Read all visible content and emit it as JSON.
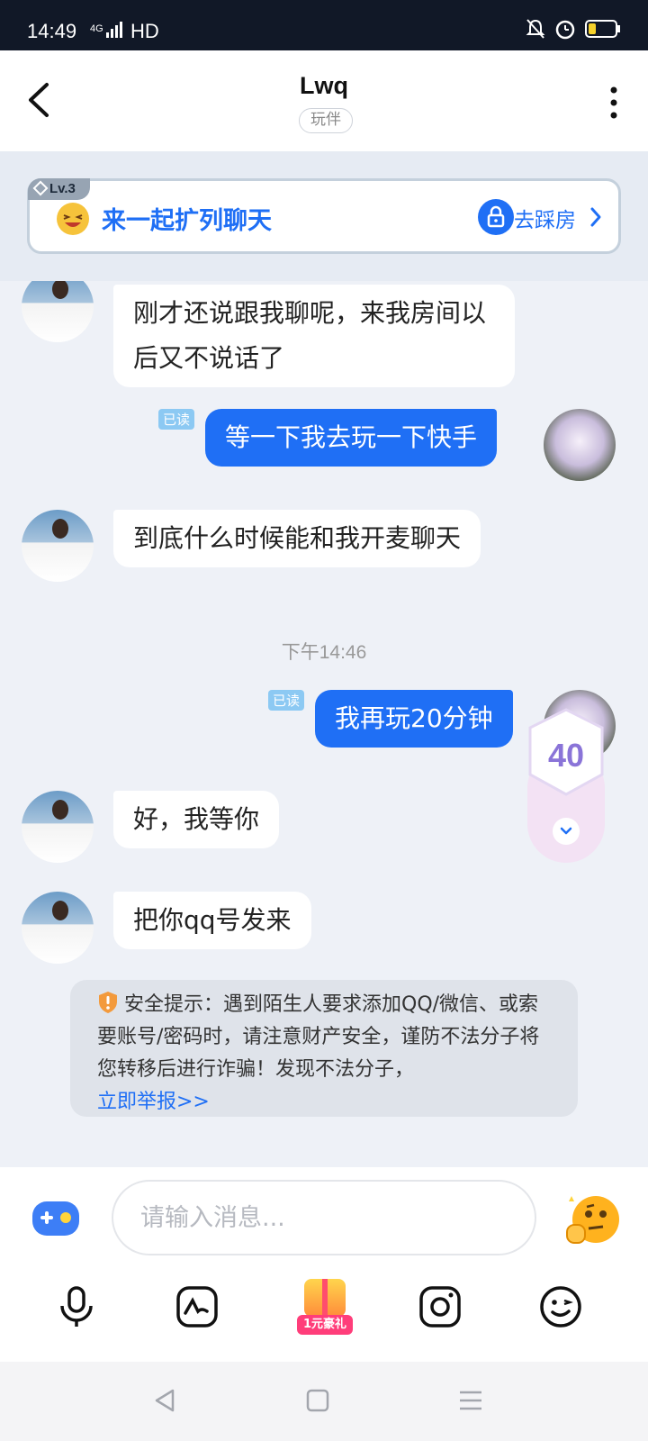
{
  "status_bar": {
    "time": "14:49",
    "network": "4G",
    "hd": "HD",
    "icons": [
      "signal-icon",
      "mute-icon",
      "alarm-icon",
      "battery-icon"
    ]
  },
  "header": {
    "title": "Lwq",
    "tag": "玩伴"
  },
  "room_banner": {
    "level": "Lv.3",
    "text": "来一起扩列聊天",
    "action": "去踩房"
  },
  "messages": [
    {
      "from": "other",
      "text": "刚才还说跟我聊呢，来我房间以后又不说话了"
    },
    {
      "from": "self",
      "text": "等一下我去玩一下快手",
      "status": "已读"
    },
    {
      "from": "other",
      "text": "到底什么时候能和我开麦聊天"
    },
    {
      "from": "self",
      "text": "我再玩20分钟",
      "status": "已读"
    },
    {
      "from": "other",
      "text": "好，我等你"
    },
    {
      "from": "other",
      "text": "把你qq号发来"
    }
  ],
  "timestamp": "下午14:46",
  "safety_notice": {
    "text": "安全提示：遇到陌生人要求添加QQ/微信、或索要账号/密码时，请注意财产安全，谨防不法分子将您转移后进行诈骗！发现不法分子，",
    "link": "立即举报>>"
  },
  "counter": {
    "value": "40"
  },
  "input": {
    "placeholder": "请输入消息...",
    "value": ""
  },
  "toolbar": {
    "gift_label": "1元豪礼",
    "icons": [
      "microphone-icon",
      "sticker-icon",
      "gift-icon",
      "camera-icon",
      "emoji-icon"
    ]
  },
  "colors": {
    "accent": "#1f6ff5",
    "chat_background": "#eef1f7",
    "read_badge": "#8cc9f3",
    "counter": "#8a74d8"
  }
}
